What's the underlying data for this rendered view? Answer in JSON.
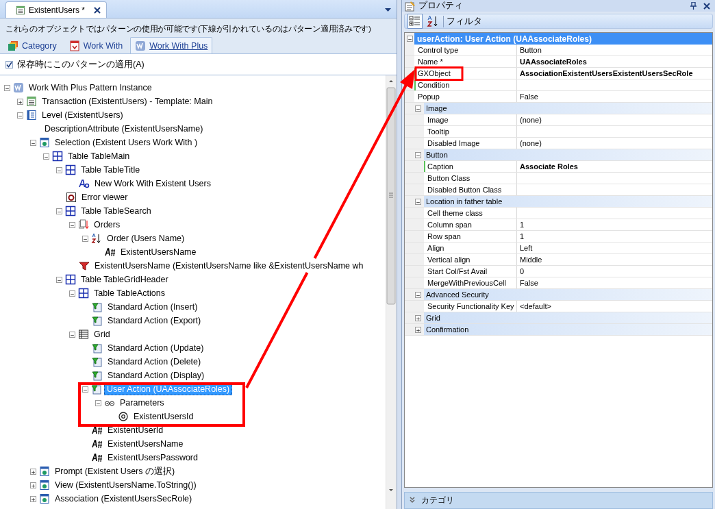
{
  "editor": {
    "document_tab": {
      "label": "ExistentUsers *",
      "selected": true
    },
    "hint": "これらのオブジェクトではパターンの使用が可能です(下線が引かれているのはパターン適用済みです)",
    "pattern_tabs": [
      {
        "kind": "category",
        "label": "Category",
        "selected": false
      },
      {
        "kind": "workwith",
        "label": "Work With",
        "selected": false
      },
      {
        "kind": "workwithplus",
        "label": "Work With Plus",
        "selected": true
      }
    ],
    "apply_on_save": {
      "label": "保存時にこのパターンの適用(A)",
      "checked": true
    },
    "tree": [
      {
        "kind": "pattern",
        "label": "Work With Plus Pattern Instance",
        "expanded": true,
        "selected": false,
        "children": [
          {
            "kind": "transaction",
            "label": "Transaction (ExistentUsers) - Template: Main",
            "expanded": false,
            "selected": false
          },
          {
            "kind": "level",
            "label": "Level (ExistentUsers)",
            "expanded": true,
            "selected": false,
            "children": [
              {
                "kind": "plain",
                "label": "DescriptionAttribute (ExistentUsersName)",
                "selected": false
              },
              {
                "kind": "selection",
                "label": "Selection (Existent Users Work With )",
                "expanded": true,
                "selected": false,
                "children": [
                  {
                    "kind": "table",
                    "label": "Table TableMain",
                    "expanded": true,
                    "selected": false,
                    "children": [
                      {
                        "kind": "table",
                        "label": "Table TableTitle",
                        "expanded": true,
                        "selected": false,
                        "children": [
                          {
                            "kind": "text",
                            "label": "New Work With Existent Users",
                            "selected": false
                          }
                        ]
                      },
                      {
                        "kind": "error",
                        "label": "Error viewer",
                        "selected": false
                      },
                      {
                        "kind": "table",
                        "label": "Table TableSearch",
                        "expanded": true,
                        "selected": false,
                        "children": [
                          {
                            "kind": "orders",
                            "label": "Orders",
                            "expanded": true,
                            "selected": false,
                            "children": [
                              {
                                "kind": "order",
                                "label": "Order (Users Name)",
                                "expanded": true,
                                "selected": false,
                                "children": [
                                  {
                                    "kind": "attribute",
                                    "label": "ExistentUsersName",
                                    "selected": false
                                  }
                                ]
                              }
                            ]
                          },
                          {
                            "kind": "filter",
                            "label": "ExistentUsersName (ExistentUsersName like &ExistentUsersName wh",
                            "selected": false
                          }
                        ]
                      },
                      {
                        "kind": "table",
                        "label": "Table TableGridHeader",
                        "expanded": true,
                        "selected": false,
                        "children": [
                          {
                            "kind": "table",
                            "label": "Table TableActions",
                            "expanded": true,
                            "selected": false,
                            "children": [
                              {
                                "kind": "action",
                                "label": "Standard Action (Insert)",
                                "selected": false
                              },
                              {
                                "kind": "action",
                                "label": "Standard Action (Export)",
                                "selected": false
                              }
                            ]
                          },
                          {
                            "kind": "grid",
                            "label": "Grid",
                            "expanded": true,
                            "selected": false,
                            "children": [
                              {
                                "kind": "action",
                                "label": "Standard Action (Update)",
                                "selected": false
                              },
                              {
                                "kind": "action",
                                "label": "Standard Action (Delete)",
                                "selected": false
                              },
                              {
                                "kind": "action",
                                "label": "Standard Action (Display)",
                                "selected": false
                              },
                              {
                                "kind": "action",
                                "label": "User Action (UAAssociateRoles)",
                                "expanded": true,
                                "selected": true,
                                "children": [
                                  {
                                    "kind": "parameters",
                                    "label": "Parameters",
                                    "expanded": true,
                                    "selected": false,
                                    "children": [
                                      {
                                        "kind": "parameter",
                                        "label": "ExistentUsersId",
                                        "selected": false
                                      }
                                    ]
                                  }
                                ]
                              },
                              {
                                "kind": "attribute",
                                "label": "ExistentUserId",
                                "selected": false
                              },
                              {
                                "kind": "attribute",
                                "label": "ExistentUsersName",
                                "selected": false
                              },
                              {
                                "kind": "attribute",
                                "label": "ExistentUsersPassword",
                                "selected": false
                              }
                            ]
                          }
                        ]
                      }
                    ]
                  }
                ]
              },
              {
                "kind": "selection",
                "label": "Prompt  (Existent Users の選択)",
                "expanded": false,
                "selected": false
              },
              {
                "kind": "selection",
                "label": "View (ExistentUsersName.ToString())",
                "expanded": false,
                "selected": false
              },
              {
                "kind": "selection",
                "label": "Association (ExistentUsersSecRole)",
                "expanded": false,
                "selected": false
              }
            ]
          }
        ]
      }
    ]
  },
  "properties": {
    "title": "プロパティ",
    "filter_label": "フィルタ",
    "object": {
      "label": "userAction: User Action (UAAssociateRoles)",
      "expanded": true
    },
    "rows": [
      {
        "name": "Control type",
        "value": "Button",
        "bold": false,
        "flagged": false
      },
      {
        "name": "Name *",
        "value": "UAAssociateRoles",
        "bold": true,
        "flagged": false
      },
      {
        "name": "GXObject",
        "value": "AssociationExistentUsersExistentUsersSecRole",
        "bold": true,
        "flagged": true
      },
      {
        "name": "Condition",
        "value": "",
        "bold": false,
        "flagged": true
      },
      {
        "name": "Popup",
        "value": "False",
        "bold": false,
        "flagged": false
      }
    ],
    "categories": [
      {
        "label": "Image",
        "expanded": true,
        "rows": [
          {
            "name": "Image",
            "value": "(none)",
            "bold": false,
            "flagged": false
          },
          {
            "name": "Tooltip",
            "value": "",
            "bold": false,
            "flagged": false
          },
          {
            "name": "Disabled Image",
            "value": "(none)",
            "bold": false,
            "flagged": false
          }
        ]
      },
      {
        "label": "Button",
        "expanded": true,
        "rows": [
          {
            "name": "Caption",
            "value": "Associate Roles",
            "bold": true,
            "flagged": true
          },
          {
            "name": "Button Class",
            "value": "",
            "bold": false,
            "flagged": false
          },
          {
            "name": "Disabled Button Class",
            "value": "",
            "bold": false,
            "flagged": false
          }
        ]
      },
      {
        "label": "Location in father table",
        "expanded": true,
        "rows": [
          {
            "name": "Cell theme class",
            "value": "",
            "bold": false,
            "flagged": false
          },
          {
            "name": "Column span",
            "value": "1",
            "bold": false,
            "flagged": false
          },
          {
            "name": "Row span",
            "value": "1",
            "bold": false,
            "flagged": false
          },
          {
            "name": "Align",
            "value": "Left",
            "bold": false,
            "flagged": false
          },
          {
            "name": "Vertical align",
            "value": "Middle",
            "bold": false,
            "flagged": false
          },
          {
            "name": "Start Col/Fst Avail",
            "value": "0",
            "bold": false,
            "flagged": false
          },
          {
            "name": "MergeWithPreviousCell",
            "value": "False",
            "bold": false,
            "flagged": false
          }
        ]
      },
      {
        "label": "Advanced Security",
        "expanded": true,
        "rows": [
          {
            "name": "Security Functionality Key",
            "value": "<default>",
            "bold": false,
            "flagged": false
          }
        ]
      },
      {
        "label": "Grid",
        "expanded": false
      },
      {
        "label": "Confirmation",
        "expanded": false
      }
    ],
    "footer": "カテゴリ"
  }
}
